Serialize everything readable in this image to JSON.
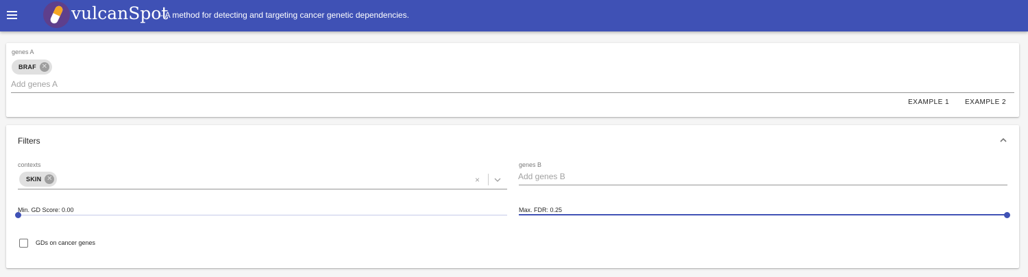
{
  "header": {
    "menu_icon": "hamburger-menu-icon",
    "logo_icon": "pill-capsule-icon",
    "title": "vulcanSpot",
    "tagline": "- A method for detecting and targeting cancer genetic dependencies.",
    "background_color": "#3f51b5"
  },
  "genes_a": {
    "label": "genes A",
    "chips": [
      {
        "label": "BRAF"
      }
    ],
    "placeholder": "Add genes A",
    "examples": [
      "EXAMPLE 1",
      "EXAMPLE 2"
    ]
  },
  "filters": {
    "title": "Filters",
    "expanded": true,
    "collapse_icon": "chevron-up-icon",
    "contexts": {
      "label": "contexts",
      "chips": [
        {
          "label": "SKIN"
        }
      ],
      "clear_icon": "×",
      "dropdown_icon": "chevron-down-icon"
    },
    "genes_b": {
      "label": "genes B",
      "placeholder": "Add genes B"
    },
    "min_gd_score": {
      "label": "Min. GD Score: 0.00",
      "value": 0.0,
      "fraction": 0.0
    },
    "max_fdr": {
      "label": "Max. FDR: 0.25",
      "value": 0.25,
      "fraction": 1.0
    },
    "cancer_genes_checkbox": {
      "label": "GDs on cancer genes",
      "checked": false
    }
  },
  "accent_color": "#3f51b5",
  "chip_delete_glyph": "✕"
}
